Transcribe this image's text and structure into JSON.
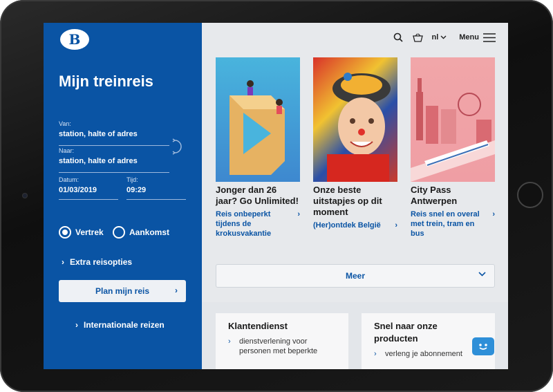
{
  "brand": {
    "logo_letter": "B",
    "primary_color": "#0a54a4"
  },
  "planner": {
    "title": "Mijn treinreis",
    "from": {
      "label": "Van:",
      "value": "station, halte of adres"
    },
    "to": {
      "label": "Naar:",
      "value": "station, halte of adres"
    },
    "date": {
      "label": "Datum:",
      "value": "01/03/2019"
    },
    "time": {
      "label": "Tijd:",
      "value": "09:29"
    },
    "radio": {
      "departure": "Vertrek",
      "arrival": "Aankomst",
      "selected": "departure"
    },
    "extra_options": "Extra reisopties",
    "plan_button": "Plan mijn reis",
    "international": "Internationale reizen"
  },
  "topbar": {
    "language": "nl",
    "menu_label": "Menu",
    "icons": [
      "search-icon",
      "basket-icon",
      "chevron-down-icon",
      "hamburger-icon"
    ]
  },
  "cards": [
    {
      "title": "Jonger dan 26 jaar? Go Unlimited!",
      "link": "Reis onbeperkt tijdens de krokusvakantie"
    },
    {
      "title": "Onze beste uitstapjes op dit moment",
      "link": "(Her)ontdek België"
    },
    {
      "title": "City Pass Antwerpen",
      "link": "Reis snel en overal met trein, tram en bus"
    }
  ],
  "more_button": "Meer",
  "boxes": [
    {
      "title": "Klantendienst",
      "item": "dienstverlening voor personen met beperkte"
    },
    {
      "title": "Snel naar onze producten",
      "item": "verleng je abonnement"
    }
  ]
}
